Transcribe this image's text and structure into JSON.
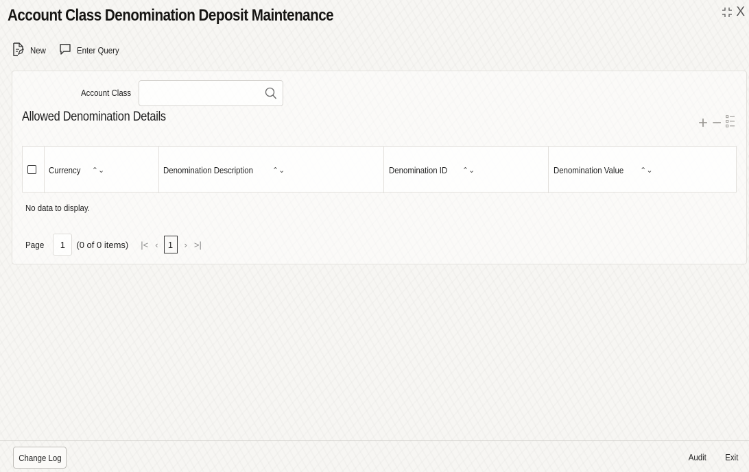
{
  "window": {
    "title": "Account Class Denomination Deposit Maintenance",
    "close_glyph": "X"
  },
  "toolbar": {
    "new_label": "New",
    "enter_query_label": "Enter Query"
  },
  "form": {
    "account_class_label": "Account Class",
    "account_class_value": "",
    "account_class_placeholder": ""
  },
  "section": {
    "title": "Allowed Denomination Details"
  },
  "table": {
    "columns": [
      {
        "label": "Currency"
      },
      {
        "label": "Denomination Description"
      },
      {
        "label": "Denomination ID"
      },
      {
        "label": "Denomination Value"
      }
    ],
    "rows": [],
    "empty_message": "No data to display."
  },
  "pagination": {
    "page_label": "Page",
    "page_value": "1",
    "count_text": "(0 of 0 items)",
    "current_page": "1"
  },
  "footer": {
    "change_log_label": "Change Log",
    "audit_label": "Audit",
    "exit_label": "Exit"
  }
}
